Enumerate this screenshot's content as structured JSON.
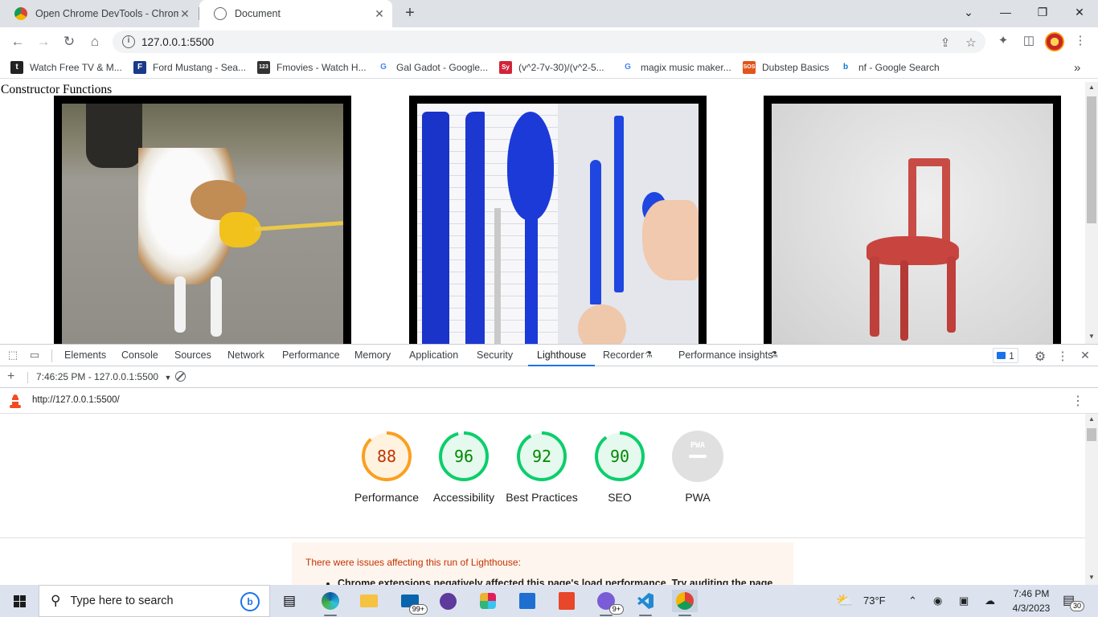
{
  "browser": {
    "tabs": [
      {
        "title": "Open Chrome DevTools - Chrome",
        "active": false
      },
      {
        "title": "Document",
        "active": true
      }
    ],
    "url": "127.0.0.1:5500",
    "new_tab_label": "+",
    "window_controls": {
      "minimize": "—",
      "maximize": "❐",
      "close": "✕"
    },
    "bookmarks": [
      {
        "label": "Watch Free TV & M...",
        "icon": "tubi-icon",
        "color": "#222222",
        "glyph": "t"
      },
      {
        "label": "Ford Mustang - Sea...",
        "icon": "mustang-icon",
        "color": "#1a3a8a",
        "glyph": "F"
      },
      {
        "label": "Fmovies - Watch H...",
        "icon": "fmovies-icon",
        "color": "#333333",
        "glyph": "123"
      },
      {
        "label": "Gal Gadot - Google...",
        "icon": "google-icon",
        "color": "#ffffff",
        "glyph": "G"
      },
      {
        "label": "(v^2-7v-30)/(v^2-5...",
        "icon": "symbolab-icon",
        "color": "#d0243a",
        "glyph": "Sy"
      },
      {
        "label": "magix music maker...",
        "icon": "google-icon",
        "color": "#ffffff",
        "glyph": "G"
      },
      {
        "label": "Dubstep Basics",
        "icon": "sos-icon",
        "color": "#e2541b",
        "glyph": "SOS"
      },
      {
        "label": "nf - Google Search",
        "icon": "bing-icon",
        "color": "#ffffff",
        "glyph": "b"
      }
    ],
    "more_bookmarks": "»"
  },
  "page": {
    "heading": "Constructor Functions",
    "images": [
      {
        "alt": "dog with duck muzzle"
      },
      {
        "alt": "blue plastic cutlery"
      },
      {
        "alt": "red chair"
      }
    ]
  },
  "devtools": {
    "tabs": [
      "Elements",
      "Console",
      "Sources",
      "Network",
      "Performance",
      "Memory",
      "Application",
      "Security",
      "Lighthouse",
      "Recorder",
      "Performance insights"
    ],
    "active_tab": "Lighthouse",
    "issues_count": "1",
    "report_selector": "7:46:25 PM - 127.0.0.1:5500",
    "report_url": "http://127.0.0.1:5500/"
  },
  "lighthouse": {
    "scores": [
      {
        "label": "Performance",
        "value": 88,
        "display": "88",
        "color": "#fa9f21",
        "text_color": "#c33300",
        "bg": "#fff3e0"
      },
      {
        "label": "Accessibility",
        "value": 96,
        "display": "96",
        "color": "#0cce6b",
        "text_color": "#008800",
        "bg": "#e6f9ee"
      },
      {
        "label": "Best Practices",
        "value": 92,
        "display": "92",
        "color": "#0cce6b",
        "text_color": "#008800",
        "bg": "#e6f9ee"
      },
      {
        "label": "SEO",
        "value": 90,
        "display": "90",
        "color": "#0cce6b",
        "text_color": "#008800",
        "bg": "#e6f9ee"
      },
      {
        "label": "PWA",
        "value": null,
        "display": "PWA",
        "color": "#e0e0e0",
        "text_color": "#ffffff",
        "bg": "#e0e0e0"
      }
    ],
    "warning_title": "There were issues affecting this run of Lighthouse:",
    "warning_item": "Chrome extensions negatively affected this page's load performance. Try auditing the page in"
  },
  "taskbar": {
    "search_placeholder": "Type here to search",
    "mail_badge": "99+",
    "discord_badge": "9+",
    "weather": "73°F",
    "time": "7:46 PM",
    "date": "4/3/2023",
    "notifications": "30"
  }
}
